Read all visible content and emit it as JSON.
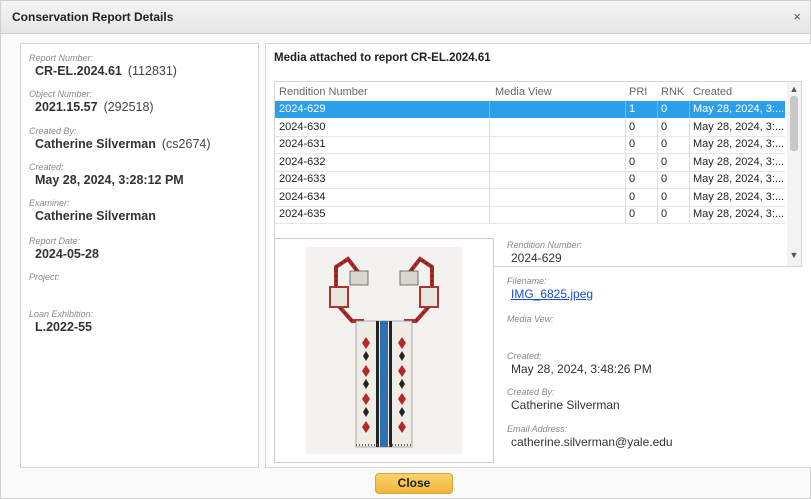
{
  "dialog": {
    "title": "Conservation Report Details",
    "close_glyph": "×"
  },
  "report": {
    "fields": [
      {
        "label": "Report Number:",
        "value": "CR-EL.2024.61",
        "sub": "(112831)"
      },
      {
        "label": "Object Number:",
        "value": "2021.15.57",
        "sub": "(292518)"
      },
      {
        "label": "Created By:",
        "value": "Catherine Silverman",
        "sub": "(cs2674)"
      },
      {
        "label": "Created:",
        "value": "May 28, 2024, 3:28:12 PM",
        "sub": ""
      },
      {
        "label": "Examiner:",
        "value": "Catherine Silverman",
        "sub": ""
      },
      {
        "label": "Report Date:",
        "value": "2024-05-28",
        "sub": ""
      },
      {
        "label": "Project:",
        "value": "",
        "sub": ""
      },
      {
        "label": "Loan Exhibition:",
        "value": "L.2022-55",
        "sub": ""
      }
    ]
  },
  "media": {
    "title": "Media attached to report CR-EL.2024.61",
    "columns": [
      "Rendition Number",
      "Media View",
      "PRI",
      "RNK",
      "Created"
    ],
    "rows": [
      {
        "rendition": "2024-629",
        "view": "",
        "pri": "1",
        "rnk": "0",
        "created": "May 28, 2024, 3:...",
        "selected": true
      },
      {
        "rendition": "2024-630",
        "view": "",
        "pri": "0",
        "rnk": "0",
        "created": "May 28, 2024, 3:...",
        "selected": false
      },
      {
        "rendition": "2024-631",
        "view": "",
        "pri": "0",
        "rnk": "0",
        "created": "May 28, 2024, 3:...",
        "selected": false
      },
      {
        "rendition": "2024-632",
        "view": "",
        "pri": "0",
        "rnk": "0",
        "created": "May 28, 2024, 3:...",
        "selected": false
      },
      {
        "rendition": "2024-633",
        "view": "",
        "pri": "0",
        "rnk": "0",
        "created": "May 28, 2024, 3:...",
        "selected": false
      },
      {
        "rendition": "2024-634",
        "view": "",
        "pri": "0",
        "rnk": "0",
        "created": "May 28, 2024, 3:...",
        "selected": false
      },
      {
        "rendition": "2024-635",
        "view": "",
        "pri": "0",
        "rnk": "0",
        "created": "May 28, 2024, 3:...",
        "selected": false
      }
    ],
    "scroll_up_icon": "▲",
    "scroll_down_icon": "▼"
  },
  "detail": {
    "rendition_label": "Rendition Number:",
    "rendition_value": "2024-629",
    "filename_label": "Filename:",
    "filename_value": "IMG_6825.jpeg",
    "mediaview_label": "Media Vew:",
    "mediaview_value": "",
    "created_label": "Created:",
    "created_value": "May 28, 2024, 3:48:26 PM",
    "createdby_label": "Created By:",
    "createdby_value": "Catherine Silverman",
    "email_label": "Email Address:",
    "email_value": "catherine.silverman@yale.edu"
  },
  "footer": {
    "close_label": "Close"
  },
  "colors": {
    "selection": "#2aa0ea",
    "accent_button": "#f4c04e",
    "link": "#1a4bd1"
  }
}
